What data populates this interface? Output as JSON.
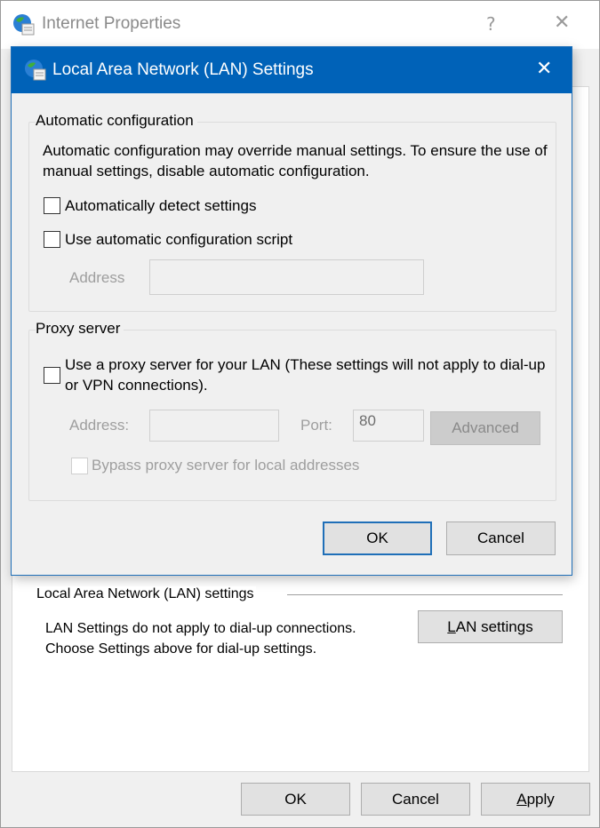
{
  "parent_window": {
    "title": "Internet Properties",
    "icon": "internet-options-globe-icon",
    "help_label": "?",
    "close_label": "✕",
    "lan_section": {
      "group_label": "Local Area Network (LAN) settings",
      "description": "LAN Settings do not apply to dial-up connections. Choose Settings above for dial-up settings.",
      "button_label_accel": "L",
      "button_label_rest": "AN settings"
    },
    "footer": {
      "ok_label": "OK",
      "cancel_label": "Cancel",
      "apply_label_accel": "A",
      "apply_label_rest": "pply"
    }
  },
  "lan_dialog": {
    "title": "Local Area Network (LAN) Settings",
    "icon": "internet-options-globe-icon",
    "close_label": "✕",
    "title_bar_color": "#0062b8",
    "automatic_configuration": {
      "group_label": "Automatic configuration",
      "description": "Automatic configuration may override manual settings.  To ensure the use of manual settings, disable automatic configuration.",
      "auto_detect": {
        "label": "Automatically detect settings",
        "checked": false
      },
      "use_script": {
        "label": "Use automatic configuration script",
        "checked": false
      },
      "address_label": "Address",
      "address_value": "",
      "address_enabled": false
    },
    "proxy_server": {
      "group_label": "Proxy server",
      "use_proxy": {
        "label": "Use a proxy server for your LAN (These settings will not apply to dial-up or VPN connections).",
        "checked": false
      },
      "address_label": "Address:",
      "address_value": "",
      "port_label": "Port:",
      "port_value": "80",
      "advanced_label": "Advanced",
      "fields_enabled": false,
      "bypass_local": {
        "label": "Bypass proxy server for local addresses",
        "checked": false,
        "enabled": false
      }
    },
    "ok_label": "OK",
    "cancel_label": "Cancel"
  }
}
